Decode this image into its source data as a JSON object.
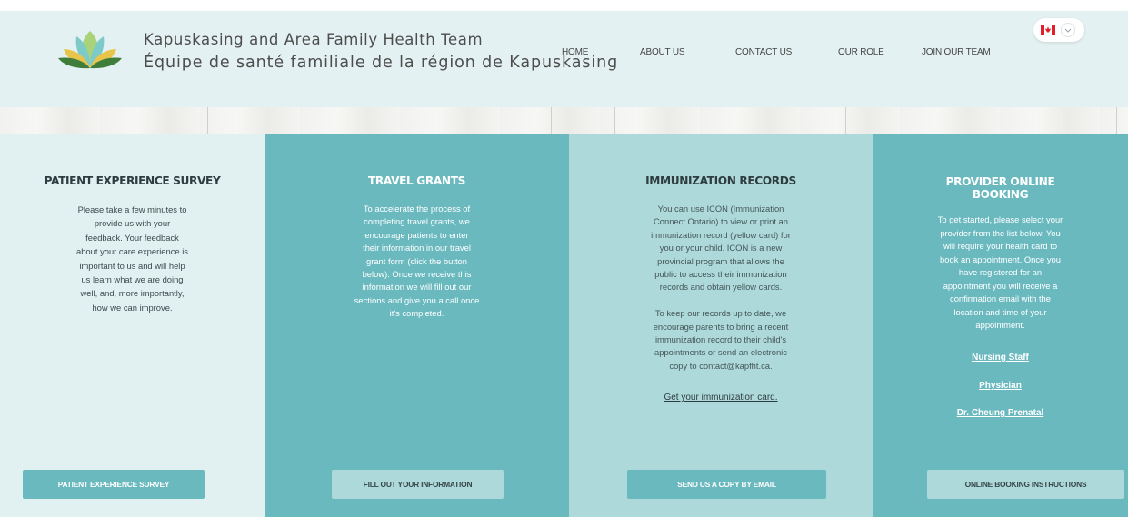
{
  "header": {
    "brand_en": "Kapuskasing and Area Family Health Team",
    "brand_fr": "Équipe de santé familiale de la région de Kapuskasing",
    "nav": {
      "home": "HOME",
      "about": "ABOUT US",
      "contact": "CONTACT US",
      "role": "OUR ROLE",
      "join": "JOIN OUR TEAM"
    },
    "language_icon": "canada-flag-icon"
  },
  "panels": {
    "survey": {
      "title": "PATIENT EXPERIENCE SURVEY",
      "lines": [
        "Please take a few minutes to",
        "provide us with your",
        "feedback. Your feedback",
        "about your care experience is",
        "important to us and will help",
        "us learn what we are doing",
        "well, and, more importantly,",
        "how we can improve."
      ],
      "button": "PATIENT EXPERIENCE SURVEY"
    },
    "travel": {
      "title": "TRAVEL GRANTS",
      "lines": [
        "To accelerate the process of",
        "completing travel grants, we",
        "encourage patients to enter",
        "their information in our travel",
        "grant form (click the button",
        "below). Once we receive this",
        "information we will fill out our",
        "sections and give you a call once",
        "it's completed."
      ],
      "button": "FILL OUT YOUR INFORMATION"
    },
    "immunization": {
      "title": "IMMUNIZATION RECORDS",
      "lines1": [
        "You can use ICON (Immunization",
        "Connect Ontario) to view or print an",
        "immunization record (yellow card) for",
        "you or your child.  ICON is a new",
        "provincial program that allows the",
        "public to access their immunization",
        "records and obtain yellow cards."
      ],
      "lines2": [
        "To keep our records up to date, we",
        "encourage parents to bring a recent",
        "immunization record to their child's",
        "appointments or send an electronic",
        "copy to contact@kapfht.ca."
      ],
      "link": "Get your immunization card.",
      "button": "SEND US A COPY BY EMAIL"
    },
    "booking": {
      "title1": "PROVIDER ONLINE",
      "title2": "BOOKING",
      "lines": [
        "To get started, please select your",
        "provider from the list below. You",
        "will require your health card to",
        "book an appointment. Once you",
        "have registered for an",
        "appointment you will receive a",
        "confirmation email with the",
        "location and time of your",
        "appointment."
      ],
      "links": [
        "Nursing Staff",
        "Physician",
        "Dr. Cheung Prenatal"
      ],
      "button": "ONLINE BOOKING INSTRUCTIONS"
    }
  },
  "colors": {
    "header_bg": "#e4f1f2",
    "teal": "#6ab9bf",
    "pale_teal": "#add9da",
    "light_panel": "#e1f1f1"
  }
}
